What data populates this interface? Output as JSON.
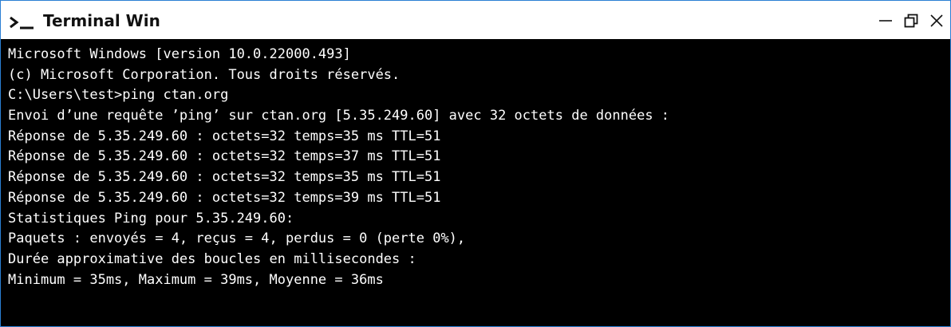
{
  "window": {
    "title": "Terminal Win",
    "prompt_icon": "terminal-prompt-icon",
    "controls": {
      "minimize_icon": "minimize-icon",
      "maximize_icon": "restore-icon",
      "close_icon": "close-icon"
    },
    "colors": {
      "border": "#2a7fd4",
      "titlebar_bg": "#ffffff",
      "terminal_bg": "#000000",
      "terminal_fg": "#ffffff"
    }
  },
  "terminal": {
    "lines": [
      "Microsoft Windows [version 10.0.22000.493]",
      "(c) Microsoft Corporation. Tous droits réservés.",
      "C:\\Users\\test>ping ctan.org",
      "Envoi d’une requête ’ping’ sur ctan.org [5.35.249.60] avec 32 octets de données :",
      "Réponse de 5.35.249.60 : octets=32 temps=35 ms TTL=51",
      "Réponse de 5.35.249.60 : octets=32 temps=37 ms TTL=51",
      "Réponse de 5.35.249.60 : octets=32 temps=35 ms TTL=51",
      "Réponse de 5.35.249.60 : octets=32 temps=39 ms TTL=51",
      "Statistiques Ping pour 5.35.249.60:",
      "Paquets : envoyés = 4, reçus = 4, perdus = 0 (perte 0%),",
      "Durée approximative des boucles en millisecondes :",
      "Minimum = 35ms, Maximum = 39ms, Moyenne = 36ms"
    ]
  }
}
